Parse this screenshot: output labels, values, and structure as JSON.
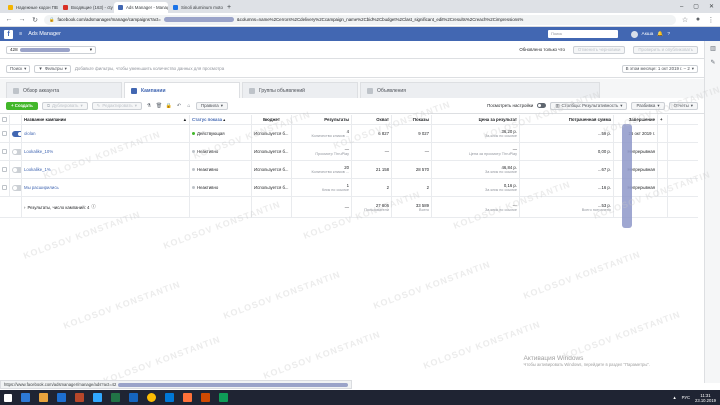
{
  "browser": {
    "tabs": [
      {
        "title": "Надежные кодон ПВХ Катер », ",
        "color": "#f4b400",
        "active": false
      },
      {
        "title": "Входящие (163) - cty359@gmai",
        "color": "#d93025",
        "active": false
      },
      {
        "title": "Ads Manager - Manage Ads - Ca",
        "color": "#4267b2",
        "active": true
      },
      {
        "title": "Sinoli aluminum motor yachts » ",
        "color": "#1a73e8",
        "active": false
      }
    ],
    "new_tab": "+",
    "url_start": "facebook.com/adsmanager/manage/campaigns?act=",
    "url_end": "&columns=name%2Cerrors%2Cdelivery%2Ccampaign_name%2Cbid%2Cbudget%2Clast_significant_edit%2Cresults%2Creach%2Cimpressions%",
    "status_url": "https://www.facebook.com/adsmanager/manage/ads?act=42"
  },
  "fb": {
    "title": "Ads Manager",
    "search_placeholder": "Поиск",
    "user_name": "Акша",
    "user_menu": "▾"
  },
  "account": {
    "selector": "428",
    "updated": "Обновлено только что",
    "discard": "Отменить черновики",
    "review": "Проверить и опубликовать",
    "date_range": "В этом месяце: 1 окт 2019 г. – 2"
  },
  "filters": {
    "search": "Поиск",
    "filters": "Фильтры",
    "hint": "Добавьте фильтры, чтобы уменьшить количество данных для просмотра"
  },
  "tabs": {
    "account": "Обзор аккаунта",
    "campaigns": "Кампании",
    "adsets": "Группы объявлений",
    "ads": "Объявления"
  },
  "toolbar": {
    "create": "+ Создать",
    "duplicate": "Дублировать",
    "edit": "Редактировать",
    "rules": "Правила",
    "view_setup": "Посмотреть настройки",
    "columns": "Столбцы: Результативность",
    "breakdown": "Разбивка",
    "reports": "Отчеты"
  },
  "table": {
    "headers": {
      "name": "Название кампании",
      "status": "Статус показа",
      "bid": "Бюджет",
      "results": "Результаты",
      "reach": "Охват",
      "impressions": "Показы",
      "cpr": "Цена за результат",
      "spend": "Потраченная сумма",
      "end": "Завершение"
    },
    "rows": [
      {
        "toggle": "on",
        "name": "ololan",
        "dot": "#42b72a",
        "status": "Действующая",
        "bid": "Используется б...",
        "results": "4",
        "results_sub": "Количество кликов ...",
        "reach": "6 827",
        "impressions": "9 027",
        "cpr": "36,20 р.",
        "cpr_sub": "За клик по ссылке",
        "spend": "...59 р.",
        "end": "26 окт 2019 г."
      },
      {
        "toggle": "off",
        "name": "Lookalike_10%",
        "dot": "#bec3c9",
        "status": "Неактивно",
        "bid": "Используется б...",
        "results": "—",
        "results_sub": "Просмотр ThruPlay",
        "reach": "—",
        "impressions": "—",
        "cpr": "—",
        "cpr_sub": "Цена за просмотр ThruPlay",
        "spend": "0,00 р.",
        "end": "Непрерывная"
      },
      {
        "toggle": "off",
        "name": "Lookalike_1%",
        "dot": "#bec3c9",
        "status": "Неактивно",
        "bid": "Используется б...",
        "results": "20",
        "results_sub": "Количество кликов ...",
        "reach": "21 158",
        "impressions": "28 570",
        "cpr": "46,84 р.",
        "cpr_sub": "За клик по ссылке",
        "spend": "...67 р.",
        "end": "Непрерывная"
      },
      {
        "toggle": "off",
        "name": "Мы расширились",
        "dot": "#bec3c9",
        "status": "Неактивно",
        "bid": "Используется б...",
        "results": "1",
        "results_sub": "Клик по ссылке",
        "reach": "2",
        "impressions": "2",
        "cpr": "0,16 р.",
        "cpr_sub": "За клик по ссылке",
        "spend": "...16 р.",
        "end": "Непрерывная"
      }
    ],
    "summary": {
      "label": "Результаты, число кампаний: 4",
      "results": "—",
      "reach": "27 806",
      "reach_sub": "Пользователи",
      "impressions": "33 589",
      "impressions_sub": "Всего",
      "cpr": "—",
      "cpr_sub": "За клик по ссылке",
      "spend": "...53 р.",
      "spend_sub": "Всего потрачено"
    }
  },
  "watermark": "KOLOSOV KONSTANTIN",
  "activation": {
    "title": "Активация Windows",
    "sub": "Чтобы активировать Windows, перейдите в раздел \"Параметры\"."
  },
  "taskbar": {
    "lang": "РУС",
    "time": "11:31",
    "date": "23.10.2019"
  }
}
